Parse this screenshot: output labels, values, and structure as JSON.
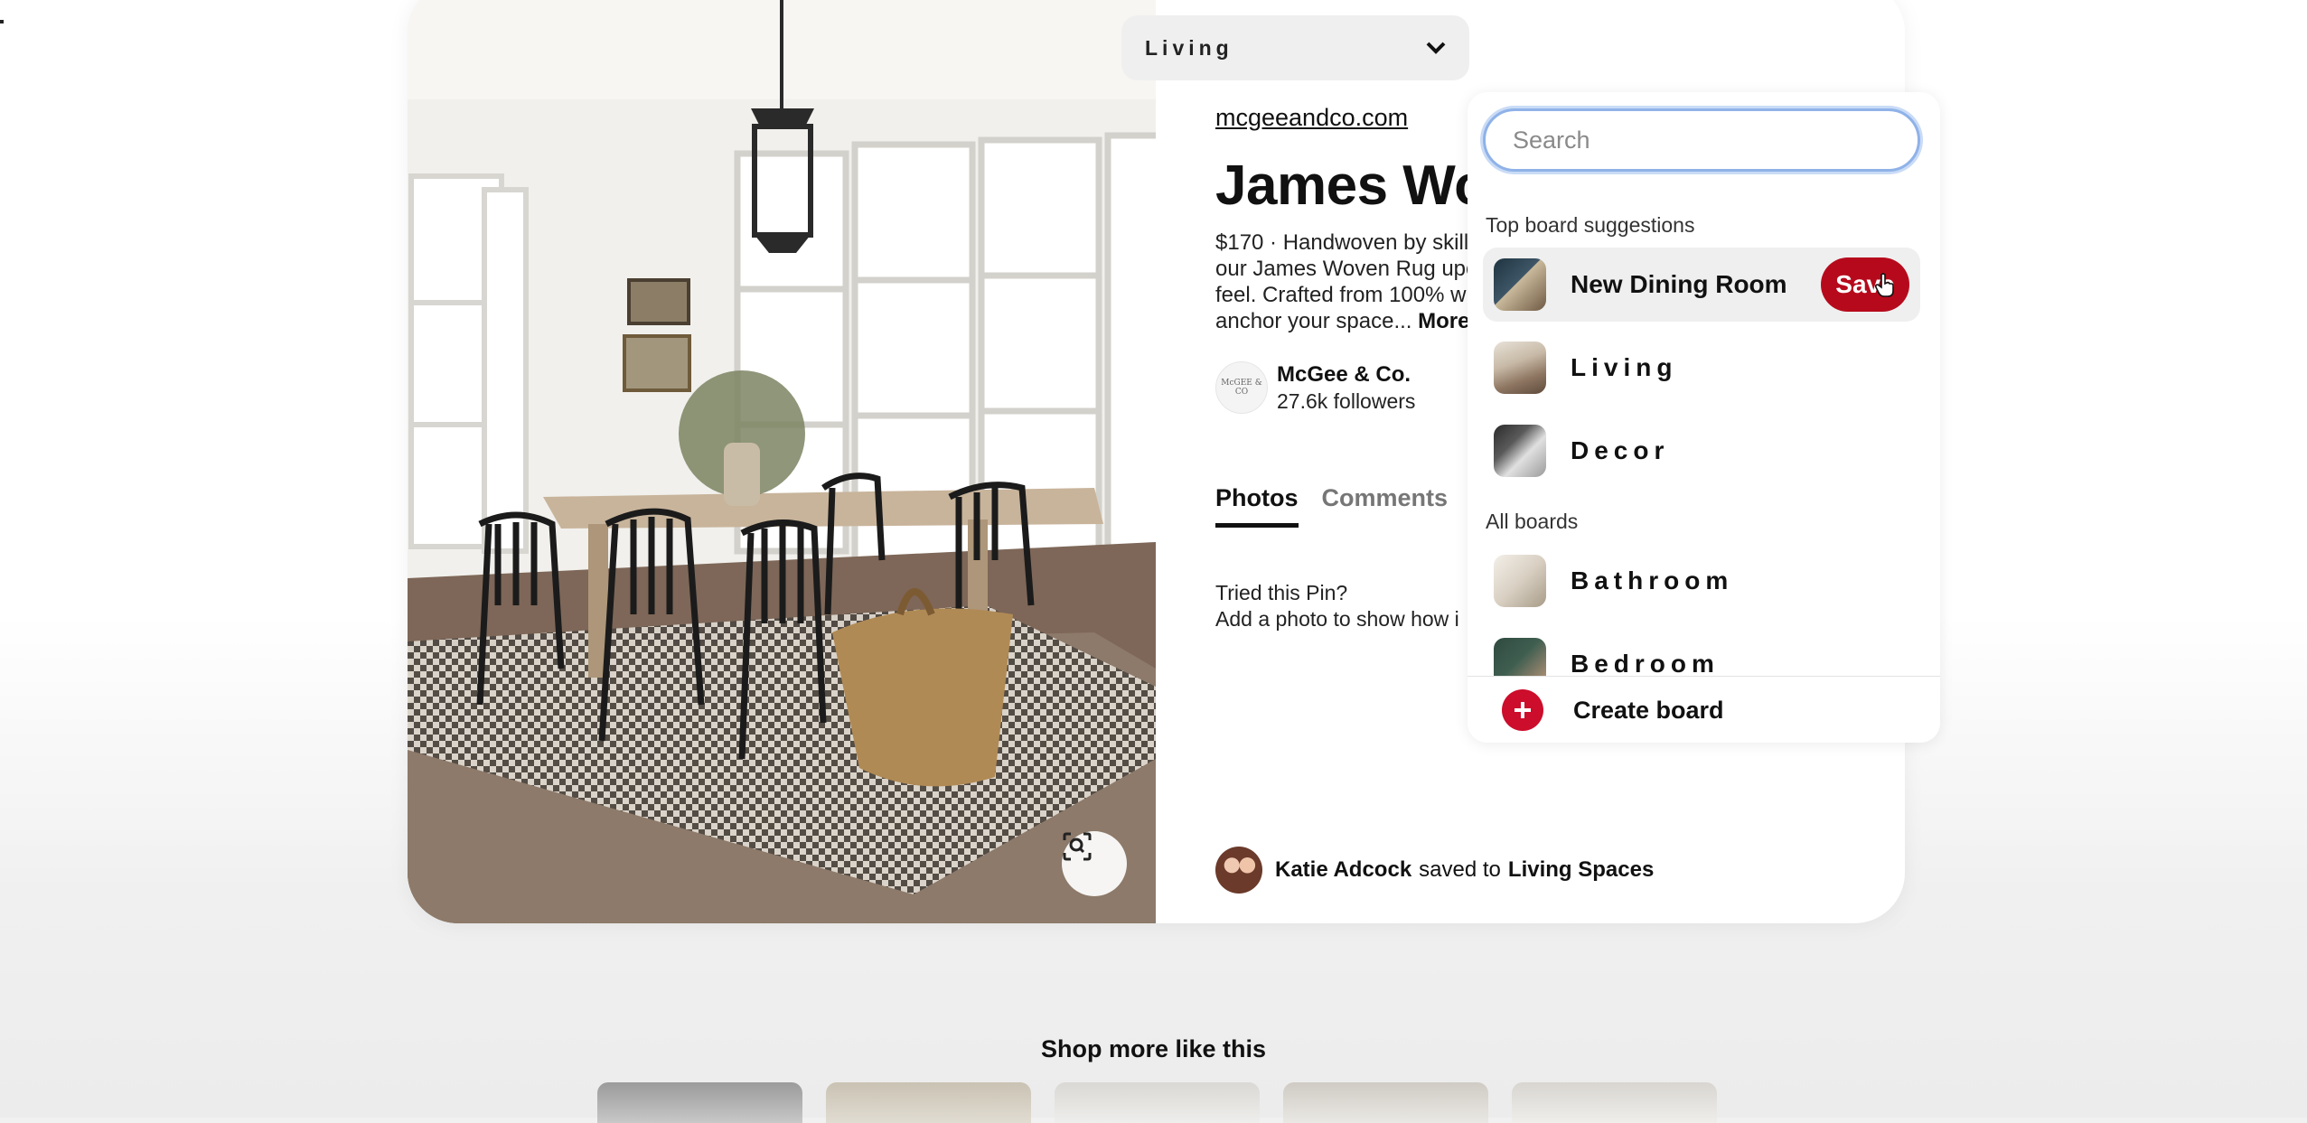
{
  "pin": {
    "domain_link": "mcgeeandco.com",
    "title": "James Wo",
    "description_lines": [
      "$170 · Handwoven by skille",
      "our James Woven Rug upc",
      "feel. Crafted from 100% w",
      "anchor your space..."
    ],
    "more_label": "More",
    "author": {
      "name": "McGee & Co.",
      "followers": "27.6k followers",
      "avatar_text": "McGEE & CO"
    },
    "tabs": [
      {
        "label": "Photos",
        "active": true
      },
      {
        "label": "Comments",
        "active": false
      }
    ],
    "tried_line1": "Tried this Pin?",
    "tried_line2": "Add a photo to show how i",
    "saved_by": {
      "user": "Katie Adcock",
      "middle": "saved to",
      "board": "Living Spaces"
    }
  },
  "toolbar": {
    "more_icon": "ellipsis-icon",
    "share_icon": "share-upload-icon",
    "board_select_label": "Living"
  },
  "board_dropdown": {
    "search_placeholder": "Search",
    "top_suggestions_label": "Top board suggestions",
    "suggestions": [
      {
        "name": "New Dining Room",
        "hover": true,
        "save_label": "Save"
      },
      {
        "name": "Living"
      },
      {
        "name": "Decor"
      }
    ],
    "all_boards_label": "All boards",
    "all_boards": [
      {
        "name": "Bathroom"
      },
      {
        "name": "Bedroom"
      }
    ],
    "create_label": "Create board"
  },
  "shop": {
    "title": "Shop more like this"
  },
  "colors": {
    "save_red": "#b60a1c",
    "create_red": "#cc0d2b",
    "search_focus": "#8fb2e8"
  }
}
